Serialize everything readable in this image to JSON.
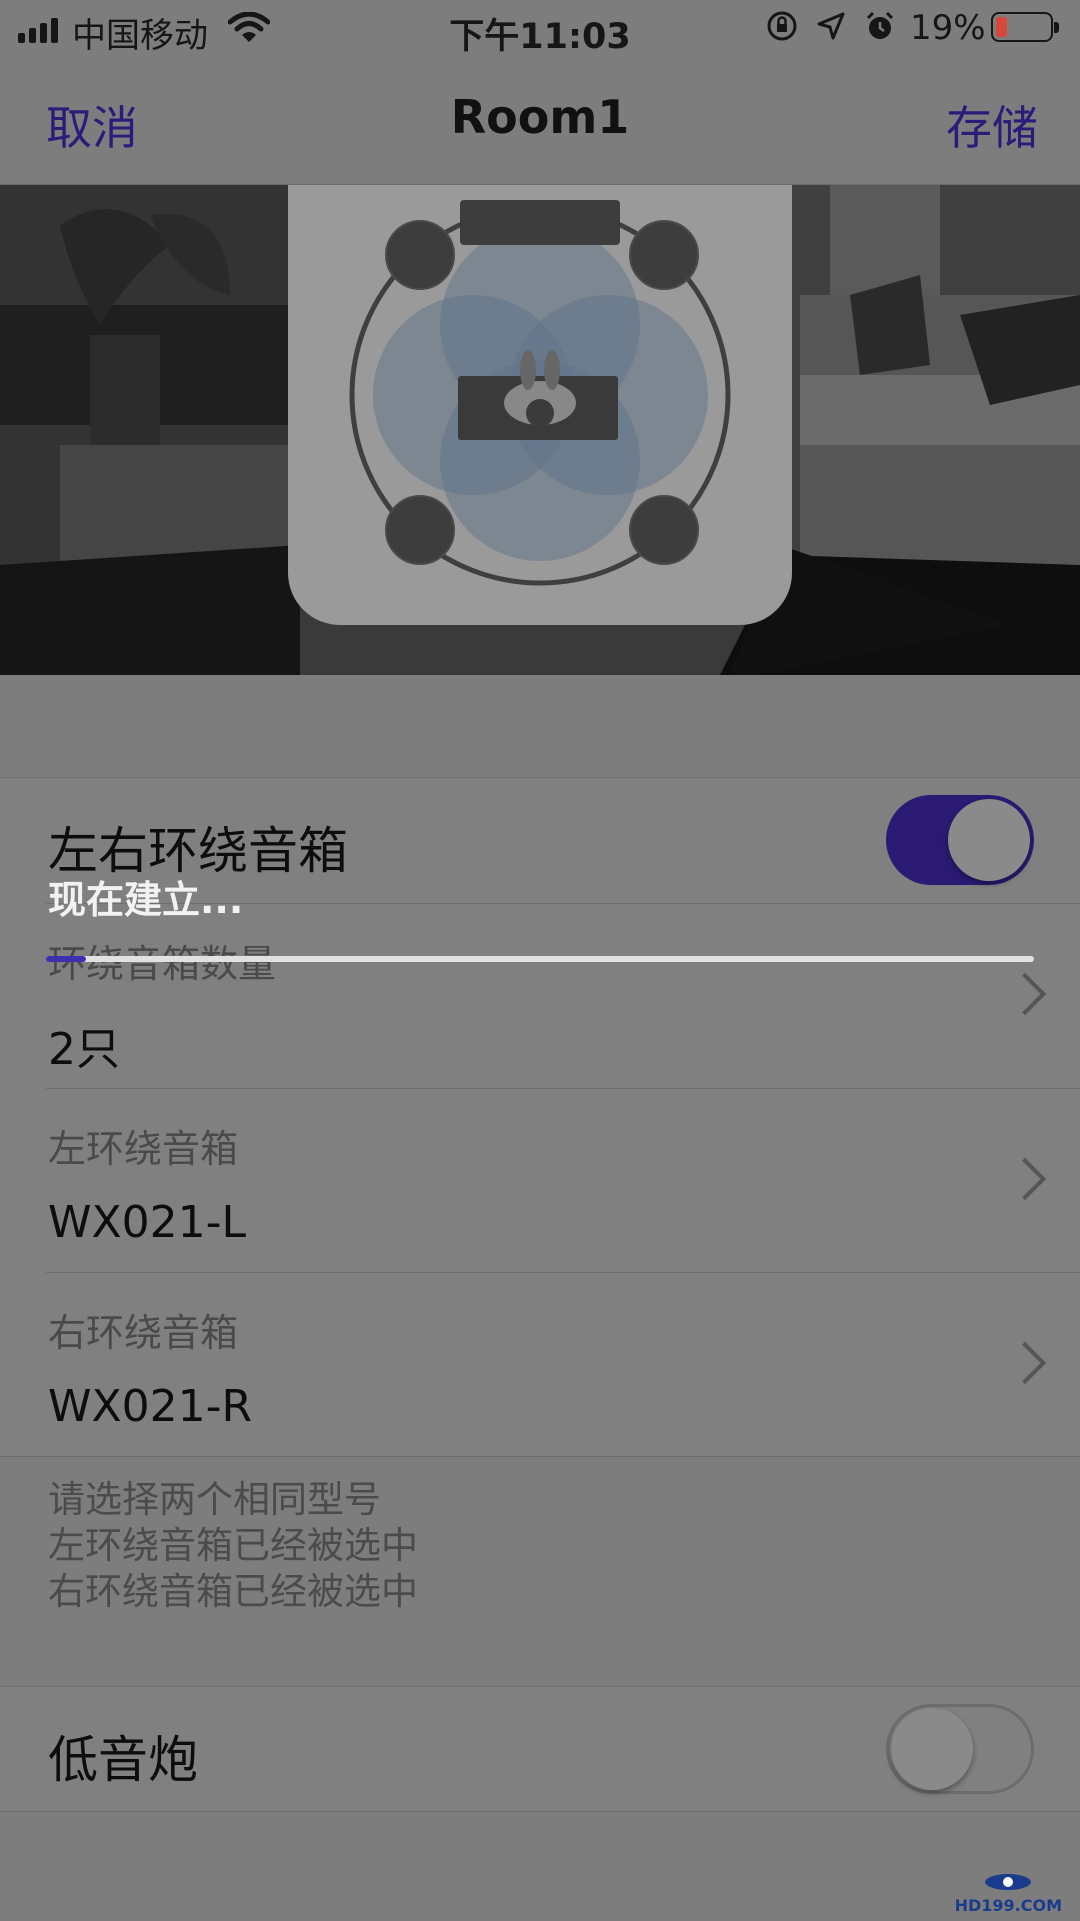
{
  "status_bar": {
    "carrier": "中国移动",
    "time": "下午11:03",
    "battery_percent": "19%",
    "battery_level": 0.19
  },
  "nav": {
    "cancel": "取消",
    "title": "Room1",
    "save": "存储"
  },
  "surround": {
    "title": "左右环绕音箱",
    "enabled": true,
    "progress_text": "现在建立...",
    "progress_value": 0.04,
    "rows": [
      {
        "caption": "环绕音箱数量",
        "value": "2只"
      },
      {
        "caption": "左环绕音箱",
        "value": "WX021-L"
      },
      {
        "caption": "右环绕音箱",
        "value": "WX021-R"
      }
    ],
    "hints": [
      "请选择两个相同型号",
      "左环绕音箱已经被选中",
      "右环绕音箱已经被选中"
    ]
  },
  "subwoofer": {
    "title": "低音炮",
    "enabled": false
  },
  "watermark": "HD199.COM",
  "colors": {
    "accent": "#2b1a74",
    "progress": "#3e2fb0",
    "battery_low": "#d9463a"
  }
}
